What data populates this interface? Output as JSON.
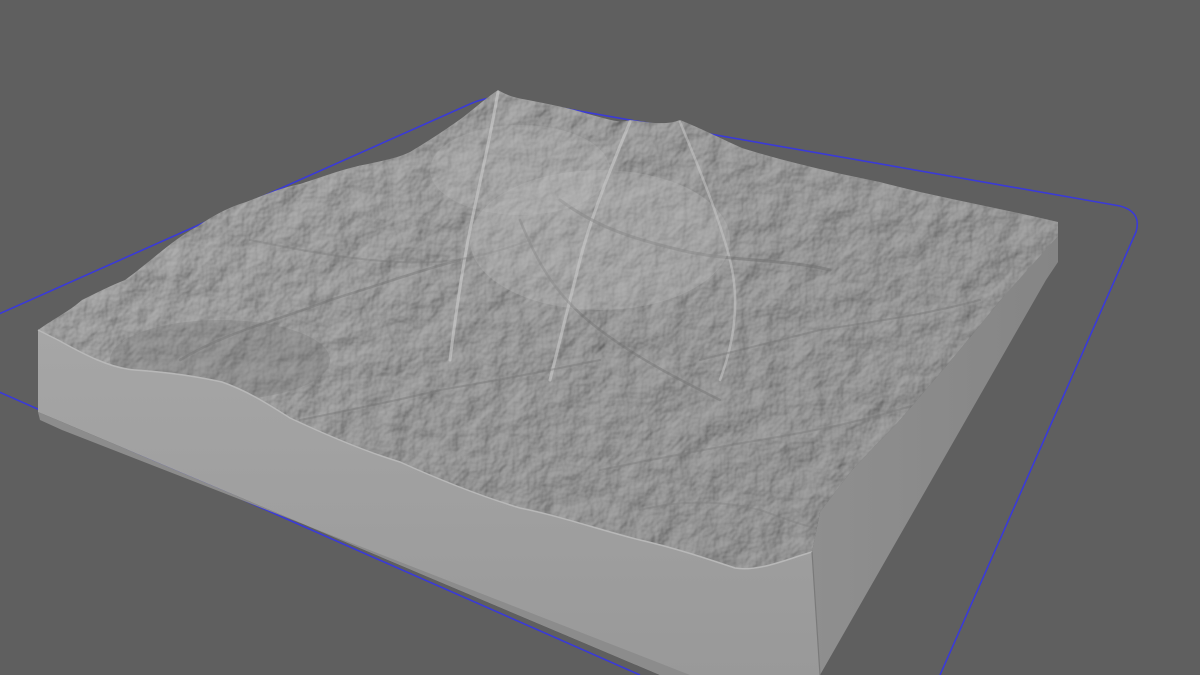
{
  "viewport": {
    "background_color": "#5f5f5f",
    "selection_outline_color": "#3a3ad8",
    "object_surface_color": "#a9a9a9",
    "object_side_color": "#9a9a9a",
    "object_shadow_color": "#7d7d7d"
  }
}
